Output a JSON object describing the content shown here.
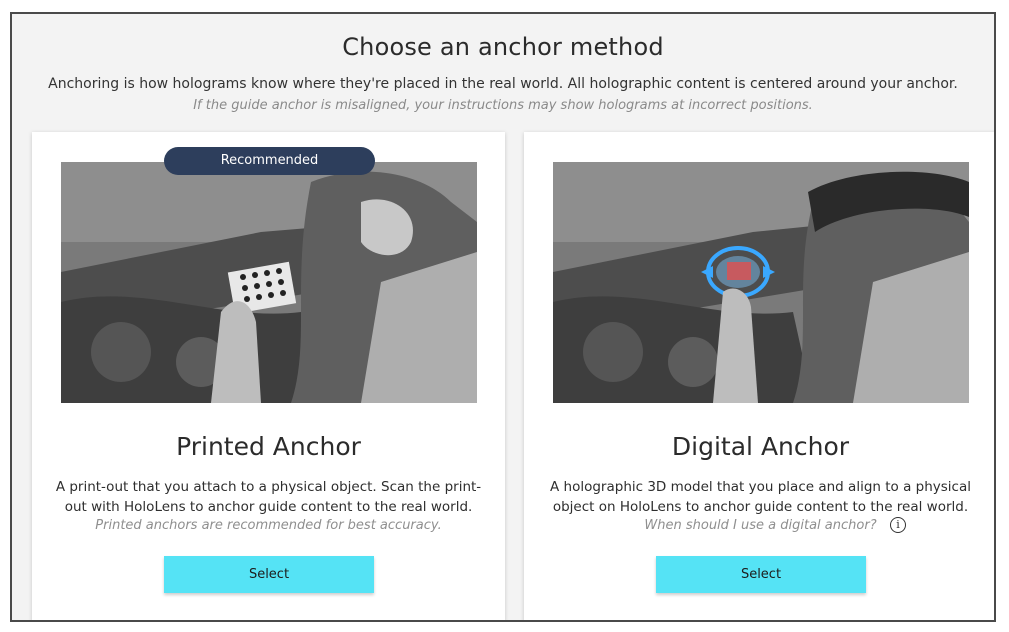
{
  "page": {
    "title": "Choose an anchor method",
    "subtitle": "Anchoring is how holograms know where they're placed in the real world. All holographic content is centered around your anchor.",
    "note": "If the guide anchor is misaligned, your instructions may show holograms at incorrect positions."
  },
  "cards": [
    {
      "badge": "Recommended",
      "title": "Printed Anchor",
      "description": "A print-out that you attach to a physical object. Scan the print-out with HoloLens to anchor guide content to the real world.",
      "note": "Printed anchors are recommended for best accuracy.",
      "button": "Select"
    },
    {
      "title": "Digital Anchor",
      "description": "A holographic 3D model that you place and align to a physical object on HoloLens to anchor guide content to the real world.",
      "note": "When should I use a digital anchor?",
      "info_icon": "i",
      "button": "Select"
    }
  ],
  "colors": {
    "button": "#55e3f5",
    "badge": "#2d3e5c",
    "hologram": "#3aa8ff"
  }
}
